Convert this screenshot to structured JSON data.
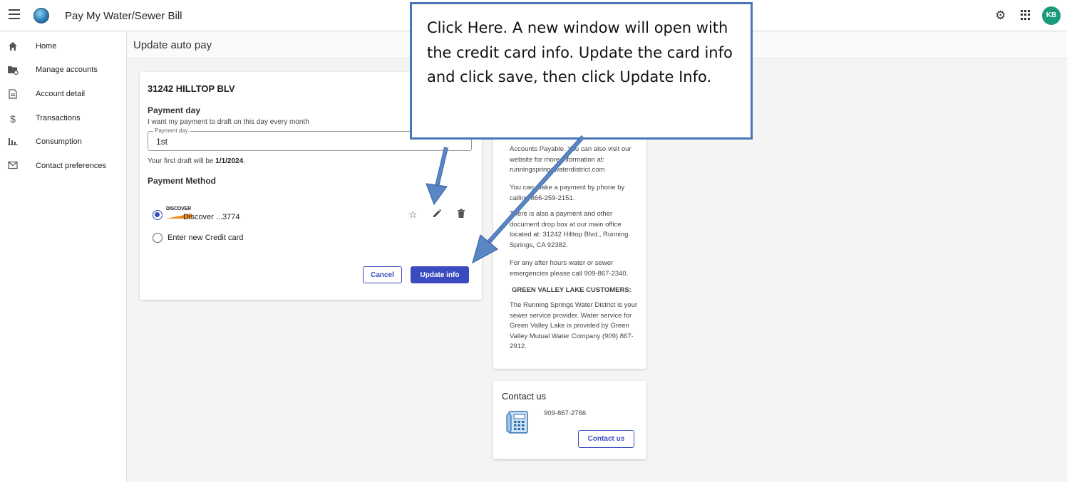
{
  "app": {
    "title": "Pay My Water/Sewer Bill",
    "user_initials": "KB",
    "colors": {
      "primary": "#3a4bbf",
      "avatar": "#1a9b7b",
      "callout_border": "#4a76b8",
      "arrow": "#5b86c4"
    }
  },
  "header": {
    "menu_icon": "hamburger-icon",
    "settings_icon": "gear-icon",
    "apps_icon": "apps-grid-icon"
  },
  "sidebar": {
    "items": [
      {
        "label": "Home",
        "icon": "home-icon"
      },
      {
        "label": "Manage accounts",
        "icon": "folder-gear-icon"
      },
      {
        "label": "Account detail",
        "icon": "document-icon"
      },
      {
        "label": "Transactions",
        "icon": "dollar-icon"
      },
      {
        "label": "Consumption",
        "icon": "bar-chart-icon"
      },
      {
        "label": "Contact preferences",
        "icon": "mail-icon"
      }
    ]
  },
  "page": {
    "title": "Update auto pay"
  },
  "autopay": {
    "address": "31242 HILLTOP BLV",
    "payment_day_title": "Payment day",
    "payment_day_desc": "I want my payment to draft on this day every month",
    "payment_day_legend": "Payment day",
    "payment_day_value": "1st",
    "first_draft_prefix": "Your first draft will be ",
    "first_draft_date": "1/1/2024",
    "first_draft_suffix": ".",
    "payment_method_title": "Payment Method",
    "card_brand": "DISCOVER",
    "card_label": "Discover ...3774",
    "card_selected": true,
    "new_card_label": "Enter new Credit card",
    "cancel_label": "Cancel",
    "update_label": "Update info"
  },
  "info": {
    "p1": "Accounts Payable. You can also visit our website for more information at: runningspringswaterdistrict.com",
    "p2": "You can make a payment by phone by calling 866-259-2151.",
    "p3": "There is also a payment and other document drop box at our main office located at: 31242 Hilltop Blvd., Running Springs, CA 92382.",
    "p4": "For any after hours water or sewer emergencies please call 909-867-2340.",
    "h1": "GREEN VALLEY LAKE CUSTOMERS:",
    "p5": "The Running Springs Water District is your sewer service provider. Water service for Green Valley Lake is provided by Green Valley Mutual Water Company (909) 867-2912."
  },
  "contact": {
    "title": "Contact us",
    "phone": "909-867-2766",
    "button_label": "Contact us"
  },
  "callout": {
    "text": "Click Here. A new window will open with the credit card info. Update the card info and click save, then click Update Info."
  }
}
